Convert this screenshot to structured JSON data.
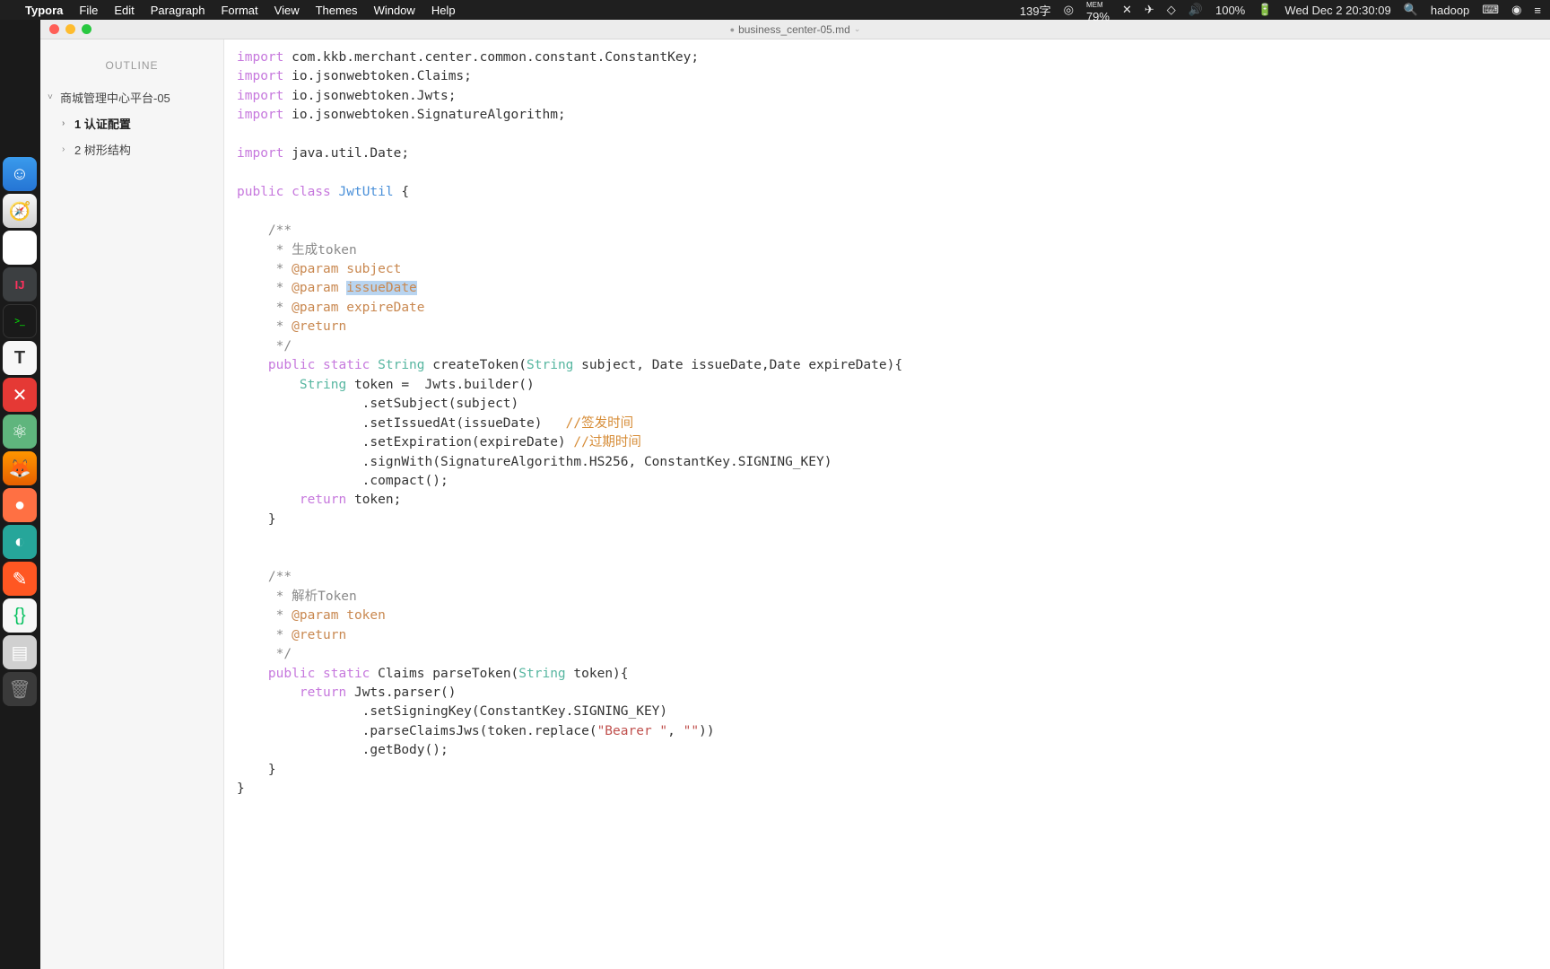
{
  "menubar": {
    "app_name": "Typora",
    "items": [
      "File",
      "Edit",
      "Paragraph",
      "Format",
      "View",
      "Themes",
      "Window",
      "Help"
    ],
    "status": {
      "word_count": "139字",
      "mem_label": "MEM",
      "mem_pct": "79%",
      "battery": "100%",
      "battery_icon": "⚡",
      "datetime": "Wed Dec 2  20:30:09",
      "user": "hadoop"
    }
  },
  "window": {
    "title": "business_center-05.md"
  },
  "sidebar": {
    "header": "OUTLINE",
    "items": [
      {
        "label": "商城管理中心平台-05",
        "level": 0,
        "bold": false,
        "chev": "˅"
      },
      {
        "label": "1 认证配置",
        "level": 1,
        "bold": true,
        "chev": "›"
      },
      {
        "label": "2 树形结构",
        "level": 1,
        "bold": false,
        "chev": "›"
      }
    ]
  },
  "code": {
    "lines": [
      {
        "tokens": [
          {
            "t": "import ",
            "c": "kw"
          },
          {
            "t": "com.kkb.merchant.center.common.constant.ConstantKey;",
            "c": ""
          }
        ]
      },
      {
        "tokens": [
          {
            "t": "import ",
            "c": "kw"
          },
          {
            "t": "io.jsonwebtoken.Claims;",
            "c": ""
          }
        ]
      },
      {
        "tokens": [
          {
            "t": "import ",
            "c": "kw"
          },
          {
            "t": "io.jsonwebtoken.Jwts;",
            "c": ""
          }
        ]
      },
      {
        "tokens": [
          {
            "t": "import ",
            "c": "kw"
          },
          {
            "t": "io.jsonwebtoken.SignatureAlgorithm;",
            "c": ""
          }
        ]
      },
      {
        "tokens": []
      },
      {
        "tokens": [
          {
            "t": "import ",
            "c": "kw"
          },
          {
            "t": "java.util.Date;",
            "c": ""
          }
        ]
      },
      {
        "tokens": []
      },
      {
        "tokens": [
          {
            "t": "public class ",
            "c": "kw"
          },
          {
            "t": "JwtUtil",
            "c": "cls"
          },
          {
            "t": " {",
            "c": ""
          }
        ]
      },
      {
        "tokens": []
      },
      {
        "tokens": [
          {
            "t": "    /**",
            "c": "doc"
          }
        ]
      },
      {
        "tokens": [
          {
            "t": "     * 生成token",
            "c": "doc"
          }
        ]
      },
      {
        "tokens": [
          {
            "t": "     * ",
            "c": "doc"
          },
          {
            "t": "@param ",
            "c": "tag"
          },
          {
            "t": "subject",
            "c": "tagname"
          }
        ]
      },
      {
        "tokens": [
          {
            "t": "     * ",
            "c": "doc"
          },
          {
            "t": "@param ",
            "c": "tag"
          },
          {
            "t": "issueDate",
            "c": "tagname hl"
          }
        ]
      },
      {
        "tokens": [
          {
            "t": "     * ",
            "c": "doc"
          },
          {
            "t": "@param ",
            "c": "tag"
          },
          {
            "t": "expireDate",
            "c": "tagname"
          }
        ]
      },
      {
        "tokens": [
          {
            "t": "     * ",
            "c": "doc"
          },
          {
            "t": "@return",
            "c": "tag"
          }
        ]
      },
      {
        "tokens": [
          {
            "t": "     */",
            "c": "doc"
          }
        ]
      },
      {
        "tokens": [
          {
            "t": "    public static ",
            "c": "kw"
          },
          {
            "t": "String",
            "c": "type"
          },
          {
            "t": " createToken(",
            "c": ""
          },
          {
            "t": "String",
            "c": "type"
          },
          {
            "t": " subject, Date issueDate,Date expireDate){",
            "c": ""
          }
        ]
      },
      {
        "tokens": [
          {
            "t": "        ",
            "c": ""
          },
          {
            "t": "String",
            "c": "type"
          },
          {
            "t": " token =  Jwts.builder()",
            "c": ""
          }
        ]
      },
      {
        "tokens": [
          {
            "t": "                .setSubject(subject)",
            "c": ""
          }
        ]
      },
      {
        "tokens": [
          {
            "t": "                .setIssuedAt(issueDate)   ",
            "c": ""
          },
          {
            "t": "//签发时间",
            "c": "cmt"
          }
        ]
      },
      {
        "tokens": [
          {
            "t": "                .setExpiration(expireDate) ",
            "c": ""
          },
          {
            "t": "//过期时间",
            "c": "cmt"
          }
        ]
      },
      {
        "tokens": [
          {
            "t": "                .signWith(SignatureAlgorithm.HS256, ConstantKey.SIGNING_KEY)",
            "c": ""
          }
        ]
      },
      {
        "tokens": [
          {
            "t": "                .compact();",
            "c": ""
          }
        ]
      },
      {
        "tokens": [
          {
            "t": "        ",
            "c": ""
          },
          {
            "t": "return",
            "c": "kw"
          },
          {
            "t": " token;",
            "c": ""
          }
        ]
      },
      {
        "tokens": [
          {
            "t": "    }",
            "c": ""
          }
        ]
      },
      {
        "tokens": []
      },
      {
        "tokens": []
      },
      {
        "tokens": [
          {
            "t": "    /**",
            "c": "doc"
          }
        ]
      },
      {
        "tokens": [
          {
            "t": "     * 解析Token",
            "c": "doc"
          }
        ]
      },
      {
        "tokens": [
          {
            "t": "     * ",
            "c": "doc"
          },
          {
            "t": "@param ",
            "c": "tag"
          },
          {
            "t": "token",
            "c": "tagname"
          }
        ]
      },
      {
        "tokens": [
          {
            "t": "     * ",
            "c": "doc"
          },
          {
            "t": "@return",
            "c": "tag"
          }
        ]
      },
      {
        "tokens": [
          {
            "t": "     */",
            "c": "doc"
          }
        ]
      },
      {
        "tokens": [
          {
            "t": "    public static ",
            "c": "kw"
          },
          {
            "t": "Claims parseToken(",
            "c": ""
          },
          {
            "t": "String",
            "c": "type"
          },
          {
            "t": " token){",
            "c": ""
          }
        ]
      },
      {
        "tokens": [
          {
            "t": "        ",
            "c": ""
          },
          {
            "t": "return",
            "c": "kw"
          },
          {
            "t": " Jwts.parser()",
            "c": ""
          }
        ]
      },
      {
        "tokens": [
          {
            "t": "                .setSigningKey(ConstantKey.SIGNING_KEY)",
            "c": ""
          }
        ]
      },
      {
        "tokens": [
          {
            "t": "                .parseClaimsJws(token.replace(",
            "c": ""
          },
          {
            "t": "\"Bearer \"",
            "c": "str"
          },
          {
            "t": ", ",
            "c": ""
          },
          {
            "t": "\"\"",
            "c": "str"
          },
          {
            "t": "))",
            "c": ""
          }
        ]
      },
      {
        "tokens": [
          {
            "t": "                .getBody();",
            "c": ""
          }
        ]
      },
      {
        "tokens": [
          {
            "t": "    }",
            "c": ""
          }
        ]
      },
      {
        "tokens": [
          {
            "t": "}",
            "c": ""
          }
        ]
      }
    ]
  },
  "dock": {
    "items": [
      {
        "name": "finder",
        "glyph": "☺",
        "cls": "dock-finder"
      },
      {
        "name": "safari",
        "glyph": "🧭",
        "cls": "dock-safari"
      },
      {
        "name": "chrome",
        "glyph": "◉",
        "cls": "dock-chrome"
      },
      {
        "name": "intellij",
        "glyph": "IJ",
        "cls": "dock-ij"
      },
      {
        "name": "terminal",
        "glyph": ">_",
        "cls": "dock-term"
      },
      {
        "name": "typora",
        "glyph": "T",
        "cls": "dock-typora"
      },
      {
        "name": "xmind",
        "glyph": "✕",
        "cls": "dock-red"
      },
      {
        "name": "atom",
        "glyph": "⚛",
        "cls": "dock-atom"
      },
      {
        "name": "firefox",
        "glyph": "🦊",
        "cls": "dock-firefox"
      },
      {
        "name": "app-orange",
        "glyph": "●",
        "cls": "dock-orange"
      },
      {
        "name": "app-teal",
        "glyph": "◐",
        "cls": "dock-teal"
      },
      {
        "name": "app-orange2",
        "glyph": "✎",
        "cls": "dock-orange2"
      },
      {
        "name": "wechat-dev",
        "glyph": "{}",
        "cls": "dock-wechat"
      },
      {
        "name": "notes",
        "glyph": "▤",
        "cls": "dock-note"
      },
      {
        "name": "trash",
        "glyph": "🗑",
        "cls": "dock-trash"
      }
    ]
  }
}
